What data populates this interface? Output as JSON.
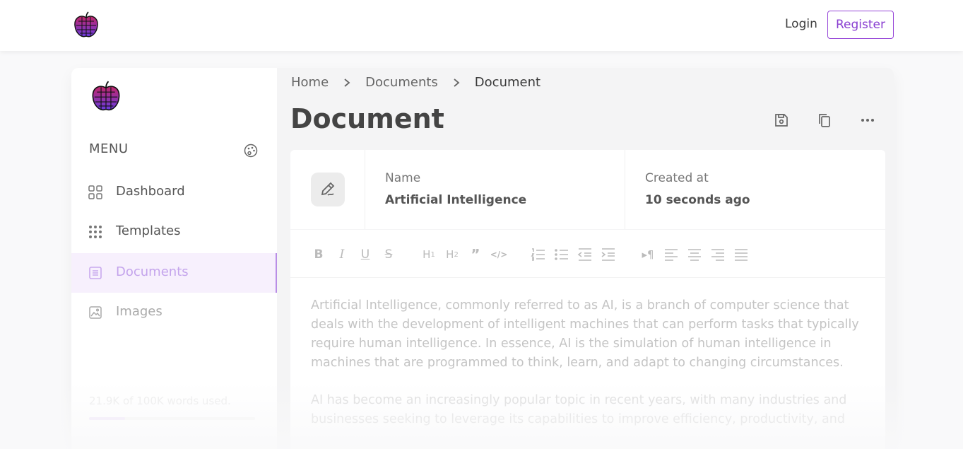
{
  "topnav": {
    "login_label": "Login",
    "register_label": "Register",
    "logo_icon": "apple-logo-icon"
  },
  "sidebar": {
    "menu_title": "MENU",
    "palette_icon": "palette-icon",
    "items": [
      {
        "label": "Dashboard",
        "icon": "dashboard-grid-icon",
        "active": false
      },
      {
        "label": "Templates",
        "icon": "dots-grid-icon",
        "active": false
      },
      {
        "label": "Documents",
        "icon": "document-icon",
        "active": true
      },
      {
        "label": "Images",
        "icon": "image-icon",
        "active": false
      }
    ],
    "usage": {
      "text": "21.9K of 100K words used.",
      "fraction": 0.219
    }
  },
  "breadcrumb": [
    "Home",
    "Documents",
    "Document"
  ],
  "page": {
    "title": "Document",
    "actions": [
      "save-icon",
      "copy-icon",
      "more-icon"
    ]
  },
  "document": {
    "name_label": "Name",
    "name_value": "Artificial Intelligence",
    "created_label": "Created at",
    "created_value": "10 seconds ago"
  },
  "toolbar": {
    "buttons": [
      "bold",
      "italic",
      "underline",
      "strikethrough",
      "heading-1",
      "heading-2",
      "blockquote",
      "code",
      "ordered-list",
      "bullet-list",
      "outdent",
      "indent",
      "paragraph-direction",
      "align-left",
      "align-center",
      "align-right",
      "align-justify"
    ]
  },
  "content": {
    "paragraphs": [
      "Artificial Intelligence, commonly referred to as AI, is a branch of computer science that deals with the development of intelligent machines that can perform tasks that typically require human intelligence. In essence, AI is the simulation of human intelligence in machines that are programmed to think, learn, and adapt to changing circumstances.",
      "AI has become an increasingly popular topic in recent years, with many industries and businesses seeking to leverage its capabilities to improve efficiency, productivity, and"
    ]
  },
  "colors": {
    "accent": "#8a3fd1",
    "active_bg": "#f7f0fd"
  }
}
